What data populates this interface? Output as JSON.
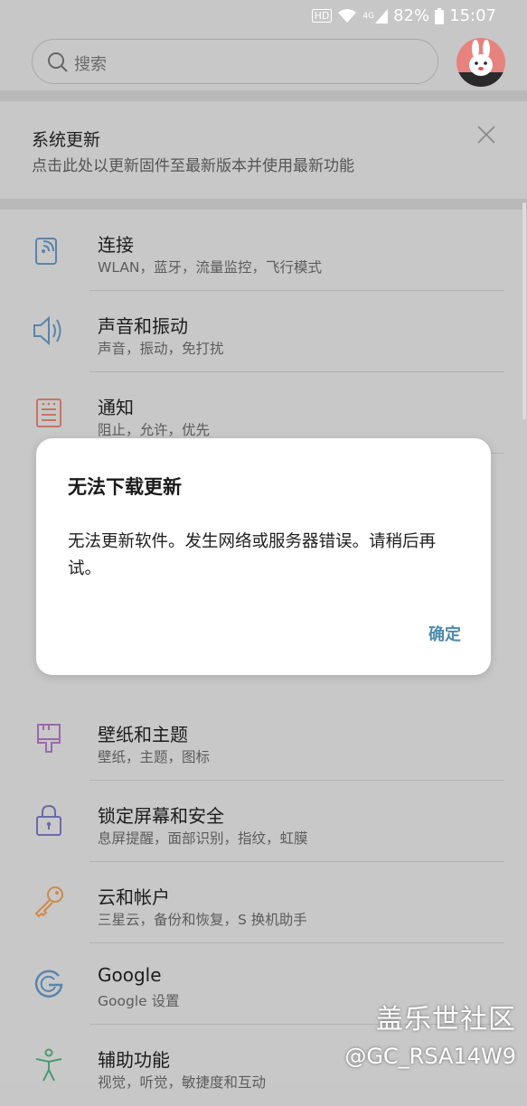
{
  "status_bar": {
    "hd": "HD",
    "network": "4G",
    "battery": "82%",
    "time": "15:07"
  },
  "search": {
    "placeholder": "搜索"
  },
  "update_banner": {
    "title": "系统更新",
    "description": "点击此处以更新固件至最新版本并使用最新功能"
  },
  "settings": [
    {
      "title": "连接",
      "subtitle": "WLAN，蓝牙，流量监控，飞行模式",
      "icon": "connections-icon",
      "color": "#5b84ab"
    },
    {
      "title": "声音和振动",
      "subtitle": "声音，振动，免打扰",
      "icon": "sound-icon",
      "color": "#5b84ab"
    },
    {
      "title": "通知",
      "subtitle": "阻止，允许，优先",
      "icon": "notifications-icon",
      "color": "#c77564"
    },
    {
      "title": "壁纸和主题",
      "subtitle": "壁纸，主题，图标",
      "icon": "brush-icon",
      "color": "#9a6aa8"
    },
    {
      "title": "锁定屏幕和安全",
      "subtitle": "息屏提醒，面部识别，指纹，虹膜",
      "icon": "lock-icon",
      "color": "#6a6aa8"
    },
    {
      "title": "云和帐户",
      "subtitle": "三星云，备份和恢复，S 换机助手",
      "icon": "key-icon",
      "color": "#cf8a4b"
    },
    {
      "title": "Google",
      "subtitle": "Google 设置",
      "icon": "google-icon",
      "color": "#5b84ab"
    },
    {
      "title": "辅助功能",
      "subtitle": "视觉，听觉，敏捷度和互动",
      "icon": "accessibility-icon",
      "color": "#4c9a72"
    }
  ],
  "dialog": {
    "title": "无法下载更新",
    "message": "无法更新软件。发生网络或服务器错误。请稍后再试。",
    "confirm": "确定"
  },
  "watermark": {
    "line1": "盖乐世社区",
    "line2": "@GC_RSA14W9"
  }
}
